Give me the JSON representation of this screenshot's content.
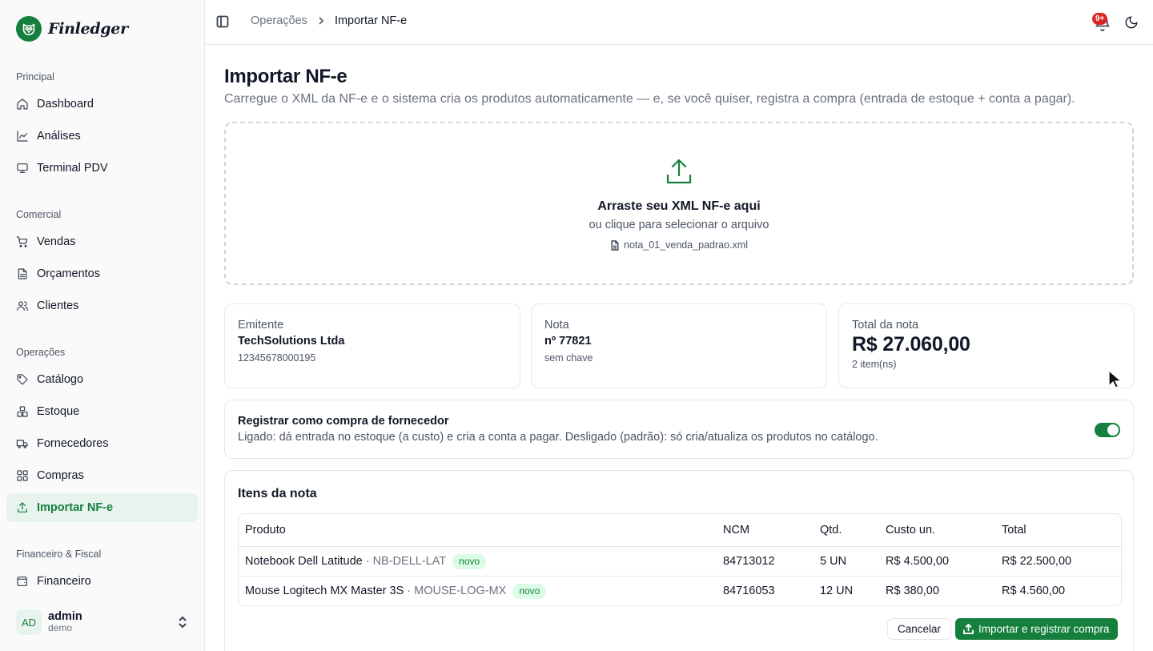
{
  "brand": {
    "name": "Finledger",
    "accent": "#15803d"
  },
  "sidebar": {
    "groups": [
      {
        "label": "Principal",
        "items": [
          {
            "label": "Dashboard",
            "icon": "home-icon"
          },
          {
            "label": "Análises",
            "icon": "line-chart-icon"
          },
          {
            "label": "Terminal PDV",
            "icon": "monitor-icon"
          }
        ]
      },
      {
        "label": "Comercial",
        "items": [
          {
            "label": "Vendas",
            "icon": "cart-icon"
          },
          {
            "label": "Orçamentos",
            "icon": "document-icon"
          },
          {
            "label": "Clientes",
            "icon": "users-icon"
          }
        ]
      },
      {
        "label": "Operações",
        "items": [
          {
            "label": "Catálogo",
            "icon": "tag-icon"
          },
          {
            "label": "Estoque",
            "icon": "boxes-icon"
          },
          {
            "label": "Fornecedores",
            "icon": "truck-icon"
          },
          {
            "label": "Compras",
            "icon": "grid-icon"
          },
          {
            "label": "Importar NF-e",
            "icon": "upload-icon",
            "active": true
          }
        ]
      },
      {
        "label": "Financeiro & Fiscal",
        "items": [
          {
            "label": "Financeiro",
            "icon": "wallet-icon"
          }
        ]
      }
    ],
    "user": {
      "initials": "AD",
      "name": "admin",
      "role": "demo"
    }
  },
  "header": {
    "breadcrumb": [
      "Operações",
      "Importar NF-e"
    ],
    "notifications_badge": "9+"
  },
  "page": {
    "title": "Importar NF-e",
    "subtitle": "Carregue o XML da NF-e e o sistema cria os produtos automaticamente — e, se você quiser, registra a compra (entrada de estoque + conta a pagar)."
  },
  "dropzone": {
    "title": "Arraste seu XML NF-e aqui",
    "subtitle": "ou clique para selecionar o arquivo",
    "file_name": "nota_01_venda_padrao.xml"
  },
  "summary": {
    "emitente": {
      "label": "Emitente",
      "value": "TechSolutions Ltda",
      "sub": "12345678000195"
    },
    "nota": {
      "label": "Nota",
      "value": "nº 77821",
      "sub": "sem chave"
    },
    "total": {
      "label": "Total da nota",
      "value": "R$ 27.060,00",
      "sub": "2 item(ns)"
    }
  },
  "register": {
    "title": "Registrar como compra de fornecedor",
    "description": "Ligado: dá entrada no estoque (a custo) e cria a conta a pagar. Desligado (padrão): só cria/atualiza os produtos no catálogo.",
    "enabled": true
  },
  "items": {
    "title": "Itens da nota",
    "columns": [
      "Produto",
      "NCM",
      "Qtd.",
      "Custo un.",
      "Total"
    ],
    "rows": [
      {
        "name": "Notebook Dell Latitude",
        "sku": "· NB-DELL-LAT",
        "badge": "novo",
        "ncm": "84713012",
        "qty": "5 UN",
        "unit_cost": "R$ 4.500,00",
        "total": "R$ 22.500,00"
      },
      {
        "name": "Mouse Logitech MX Master 3S",
        "sku": "· MOUSE-LOG-MX",
        "badge": "novo",
        "ncm": "84716053",
        "qty": "12 UN",
        "unit_cost": "R$ 380,00",
        "total": "R$ 4.560,00"
      }
    ],
    "cancel_label": "Cancelar",
    "import_label": "Importar e registrar compra"
  }
}
